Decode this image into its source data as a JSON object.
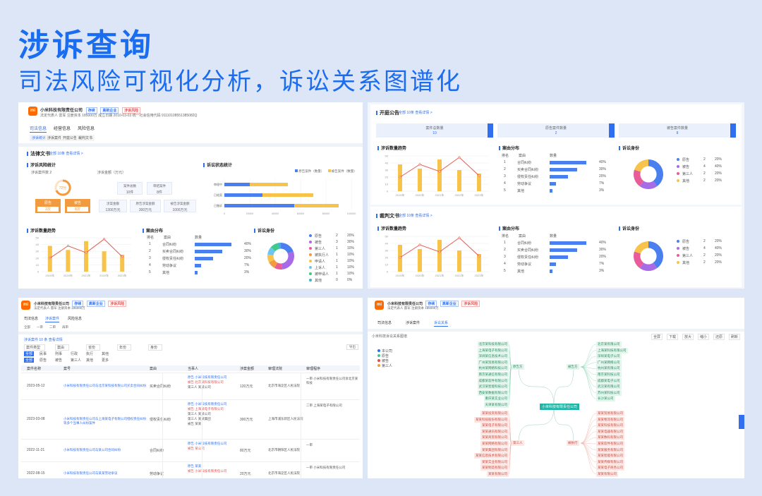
{
  "hero": {
    "title": "涉诉查询",
    "subtitle": "司法风险可视化分析，诉讼关系图谱化"
  },
  "colors": {
    "accent": "#2f6ff0",
    "bar_yellow": "#f8c34a",
    "line_red": "#e8584e",
    "bar_blue": "#4a7ff0",
    "orange": "#f29a3f"
  },
  "company": {
    "logo": "mi",
    "name": "小米科技有限责任公司",
    "tag1": "存续",
    "tag2": "高新企业",
    "tag3": "涉诉风险",
    "info": "法定代表人  雷军  注册资本 185000万  成立日期 2010-03-03  统一社会信用代码 91110108551385082Q",
    "info_short": "法定代表人 雷军  注册资本 185000万"
  },
  "p1": {
    "tabs": [
      "司法信息",
      "经营信息",
      "风险信息"
    ],
    "subtabs": [
      "涉诉统计",
      "涉诉案件",
      "开庭公告",
      "裁判文书"
    ],
    "section": "法律文书",
    "section_note": "全部  10条  查看详情 >",
    "risk_title": "涉诉风险统计",
    "risk_label": "涉诉案件数 2",
    "risk_label2": "涉诉金额（万元）",
    "gauge_value": "72分",
    "orange_cards": [
      {
        "label": "原告",
        "value": "2次"
      },
      {
        "label": "被告",
        "value": "8次"
      }
    ],
    "mini_cards": [
      {
        "label": "案件总数",
        "value": "10件"
      },
      {
        "label": "审结案件",
        "value": "8件"
      },
      {
        "label": "涉案金额",
        "value": "1300万元"
      },
      {
        "label": "原告涉案金额",
        "value": "300万元"
      },
      {
        "label": "被告涉案金额",
        "value": "1000万元"
      }
    ],
    "status_title": "诉讼状态统计",
    "status_legend": [
      "原告案件（数量）",
      "被告案件（数量）"
    ],
    "status_cats": [
      "审理中",
      "已结案",
      "已撤诉"
    ],
    "status_vals": [
      [
        8,
        12
      ],
      [
        12,
        16
      ],
      [
        22,
        14
      ]
    ],
    "status_ticks": [
      "0",
      "20000",
      "40000",
      "60000",
      "80000",
      "100000"
    ],
    "trend_title": "涉诉数量趋势",
    "trend_years": [
      "2019年",
      "2020年",
      "2021年",
      "2022年",
      "2023年"
    ],
    "trend_bars": [
      38,
      32,
      45,
      30,
      25
    ],
    "trend_line": [
      20,
      38,
      28,
      48,
      22
    ],
    "trend_yticks": [
      "50",
      "40",
      "30",
      "20",
      "10",
      "0"
    ],
    "cause_title": "案由分布",
    "cause_head": [
      "排名",
      "案由",
      "数量"
    ],
    "cause_rows": [
      {
        "rank": "1",
        "name": "合同纠纷",
        "v": 40,
        "pct": "40%"
      },
      {
        "rank": "2",
        "name": "买卖合同纠纷",
        "v": 30,
        "pct": "30%"
      },
      {
        "rank": "3",
        "name": "侵权责任纠纷",
        "v": 20,
        "pct": "20%"
      },
      {
        "rank": "4",
        "name": "劳动争议",
        "v": 7,
        "pct": "7%"
      },
      {
        "rank": "5",
        "name": "其他",
        "v": 3,
        "pct": "3%"
      }
    ],
    "role_title": "诉讼身份",
    "role_legend": [
      {
        "name": "原告",
        "c": "#4a7ff0",
        "n": "2",
        "p": "20%"
      },
      {
        "name": "被告",
        "c": "#a86be8",
        "n": "3",
        "p": "30%"
      },
      {
        "name": "第三人",
        "c": "#e85c9a",
        "n": "1",
        "p": "10%"
      },
      {
        "name": "被执行人",
        "c": "#f29a3f",
        "n": "1",
        "p": "10%"
      },
      {
        "name": "申请人",
        "c": "#f8c34a",
        "n": "1",
        "p": "10%"
      },
      {
        "name": "上诉人",
        "c": "#6cc5f0",
        "n": "1",
        "p": "10%"
      },
      {
        "name": "被申请人",
        "c": "#3fc98a",
        "n": "1",
        "p": "10%"
      },
      {
        "name": "其他",
        "c": "#3fb5c9",
        "n": "0",
        "p": "0%"
      }
    ],
    "role_values": [
      2,
      3,
      1,
      1,
      1,
      1,
      1,
      0.4
    ]
  },
  "p2": {
    "s1": "开庭公告",
    "s1_note": "全部  10条  查看详情 >",
    "headers": [
      "案件总数量",
      "原告案件数量",
      "被告案件数量"
    ],
    "header_vals": [
      "10",
      "2",
      "8"
    ],
    "trend_title": "涉诉数量趋势",
    "years": [
      "2019年",
      "2020年",
      "2021年",
      "2022年",
      "2023年"
    ],
    "bars1": [
      38,
      32,
      45,
      30,
      25
    ],
    "line1": [
      20,
      38,
      28,
      48,
      22
    ],
    "yticks": [
      "50",
      "40",
      "30",
      "20",
      "10",
      "0"
    ],
    "cause_title": "案由分布",
    "cause_head": [
      "排名",
      "案由",
      "数量"
    ],
    "cause_rows": [
      {
        "rank": "1",
        "name": "合同纠纷",
        "v": 40,
        "pct": "40%"
      },
      {
        "rank": "2",
        "name": "买卖合同纠纷",
        "v": 30,
        "pct": "30%"
      },
      {
        "rank": "3",
        "name": "侵权责任纠纷",
        "v": 20,
        "pct": "20%"
      },
      {
        "rank": "4",
        "name": "劳动争议",
        "v": 7,
        "pct": "7%"
      },
      {
        "rank": "5",
        "name": "其他",
        "v": 3,
        "pct": "3%"
      }
    ],
    "role_title": "诉讼身份",
    "role_legend": [
      {
        "name": "原告",
        "c": "#4a7ff0",
        "n": "2",
        "p": "20%"
      },
      {
        "name": "被告",
        "c": "#a86be8",
        "n": "4",
        "p": "40%"
      },
      {
        "name": "第三人",
        "c": "#e85c9a",
        "n": "2",
        "p": "20%"
      },
      {
        "name": "其他",
        "c": "#f8c34a",
        "n": "2",
        "p": "20%"
      }
    ],
    "role_values": [
      4,
      2,
      2,
      2
    ],
    "s2": "裁判文书",
    "s2_note": "全部  10条  查看详情 >"
  },
  "p3": {
    "tabs": [
      "司法信息",
      "涉诉案件",
      "风险信息"
    ],
    "subtabs": [
      "全部",
      "一审",
      "二审",
      "再审"
    ],
    "count": "涉诉案件  10  条  查看详情",
    "export": "导出",
    "filters": [
      "案件类型",
      "案由",
      "省份",
      "年份",
      "身份"
    ],
    "filter_rows": [
      [
        "全部",
        "民事",
        "刑事",
        "行政",
        "执行",
        "其他"
      ],
      [
        "全部",
        "原告",
        "被告",
        "第三人",
        "其他",
        "更多"
      ]
    ],
    "cols": [
      "案件名称",
      "案号",
      "案由",
      "当事人",
      "涉案金额",
      "审理法院",
      "审理程序"
    ],
    "rows": [
      {
        "date": "2023-05-12",
        "name": "小米科技有限责任公司与北京某科技有限公司买卖合同纠纷",
        "cause": "买卖合同纠纷",
        "parties": [
          "原告 小米科技有限责任公司",
          "被告 北京某科技有限公司",
          "第三人 某某公司"
        ],
        "amount": "120万元",
        "court": "北京市海淀区人民法院",
        "proc": "一审 小米科技有限责任公司诉北京某科技"
      },
      {
        "date": "2023-03-08",
        "name": "小米科技有限责任公司与上海某电子有限公司侵权责任纠纷等多个当事人纠纷案件",
        "cause": "侵权责任纠纷",
        "parties": [
          "原告 小米科技有限责任公司",
          "被告 上海某电子有限公司",
          "第三人 某某公司",
          "第三人 某某集团",
          "被告 某某"
        ],
        "amount": "300万元",
        "court": "上海市浦东新区人民法院",
        "proc": "二审 上海某电子有限公司"
      },
      {
        "date": "2022-11-21",
        "name": "小米科技有限责任公司与某公司合同纠纷",
        "cause": "合同纠纷",
        "parties": [
          "原告 小米科技有限责任公司",
          "被告 某公司"
        ],
        "amount": "80万元",
        "court": "北京市朝阳区人民法院",
        "proc": "一审"
      },
      {
        "date": "2022-08-15",
        "name": "小米科技有限责任公司与某某劳动争议",
        "cause": "劳动争议",
        "parties": [
          "原告 某某",
          "被告 小米科技有限责任公司"
        ],
        "amount": "20万元",
        "court": "北京市海淀区人民法院",
        "proc": "一审 小米科技有限责任公司"
      }
    ]
  },
  "p4": {
    "tabs": [
      "司法信息",
      "涉诉案件",
      "诉讼关系"
    ],
    "graph_title": "小米科技诉讼关系图谱",
    "toolbar": [
      "全屏",
      "下载",
      "放大",
      "缩小",
      "还原",
      "刷新"
    ],
    "legend": [
      "本公司",
      "原告",
      "被告",
      "第三人"
    ],
    "center": "小米科技有限责任公司",
    "mid_left": "原告方",
    "mid_right": "被告方",
    "mid_left2": "第三人",
    "mid_right2": "被执行",
    "green_left": [
      "北京某科技有限公司",
      "上海某电子有限公司",
      "深圳某信息技术公司",
      "广州某贸易有限公司",
      "杭州某网络科技公司",
      "南京某通信有限公司",
      "成都某软件有限公司",
      "武汉某智能科技公司",
      "西安某数据有限公司",
      "重庆某实业公司",
      "天津某有限公司"
    ],
    "green_right": [
      "北京某有限公司",
      "上海某科技有限公司",
      "深圳某电子公司",
      "广州某网络公司",
      "杭州某有限公司",
      "南京某科技公司",
      "成都某电子公司",
      "武汉某有限公司",
      "苏州某科技公司",
      "长沙某公司"
    ],
    "red_left": [
      "某某投资有限公司",
      "某某科技股份有限公司",
      "某某电子有限公司",
      "某某通讯有限公司",
      "某某商贸有限公司",
      "某某网络有限公司",
      "某某集团有限公司",
      "某某信息技术有限公司",
      "某某实业有限公司",
      "某某制造有限公司",
      "某某有限公司"
    ],
    "red_right": [
      "某某贸易有限公司",
      "某某物流有限公司",
      "某某科技有限公司",
      "某某电器有限公司",
      "某某数码有限公司",
      "某某软件有限公司",
      "某某服务有限公司",
      "某某智能有限公司",
      "某某传媒有限公司",
      "某某电子商务公司",
      "某某有限公司"
    ]
  }
}
